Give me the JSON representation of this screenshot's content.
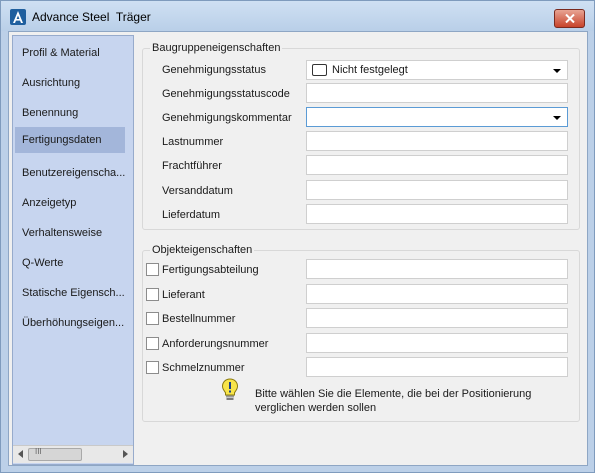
{
  "window": {
    "title": "Advance Steel  Träger",
    "app_icon": "autodesk-a-icon",
    "close_icon": "close-icon"
  },
  "sidebar": {
    "items": [
      {
        "label": "Profil & Material",
        "selected": false
      },
      {
        "label": "Ausrichtung",
        "selected": false
      },
      {
        "label": "Benennung",
        "selected": false
      },
      {
        "label": "Fertigungsdaten",
        "selected": true
      },
      {
        "label": "Benutzereigenscha...",
        "selected": false
      },
      {
        "label": "Anzeigetyp",
        "selected": false
      },
      {
        "label": "Verhaltensweise",
        "selected": false
      },
      {
        "label": "Q-Werte",
        "selected": false
      },
      {
        "label": "Statische Eigensch...",
        "selected": false
      },
      {
        "label": "Überhöhungseigen...",
        "selected": false
      }
    ],
    "scroll_grip": "III"
  },
  "assembly": {
    "title": "Baugruppeneigenschaften",
    "fields": [
      {
        "label": "Genehmigungsstatus",
        "value": "Nicht festgelegt",
        "type": "dropdown"
      },
      {
        "label": "Genehmigungsstatuscode",
        "value": "",
        "type": "text"
      },
      {
        "label": "Genehmigungskommentar",
        "value": "",
        "type": "dropdown"
      },
      {
        "label": "Lastnummer",
        "value": "",
        "type": "text"
      },
      {
        "label": "Frachtführer",
        "value": "",
        "type": "text"
      },
      {
        "label": "Versanddatum",
        "value": "",
        "type": "text"
      },
      {
        "label": "Lieferdatum",
        "value": "",
        "type": "text"
      }
    ]
  },
  "object": {
    "title": "Objekteigenschaften",
    "fields": [
      {
        "label": "Fertigungsabteilung",
        "checked": false,
        "value": ""
      },
      {
        "label": "Lieferant",
        "checked": false,
        "value": ""
      },
      {
        "label": "Bestellnummer",
        "checked": false,
        "value": ""
      },
      {
        "label": "Anforderungsnummer",
        "checked": false,
        "value": ""
      },
      {
        "label": "Schmelznummer",
        "checked": false,
        "value": ""
      }
    ],
    "info_icon": "lightbulb-icon",
    "info_text": "Bitte wählen Sie die Elemente, die bei der Positionierung verglichen werden sollen"
  },
  "colors": {
    "sidebar_bg": "#c7d5ef",
    "sidebar_selected": "#a3b6da",
    "close_button": "#c7432b",
    "focus_border": "#5b9bd5"
  }
}
